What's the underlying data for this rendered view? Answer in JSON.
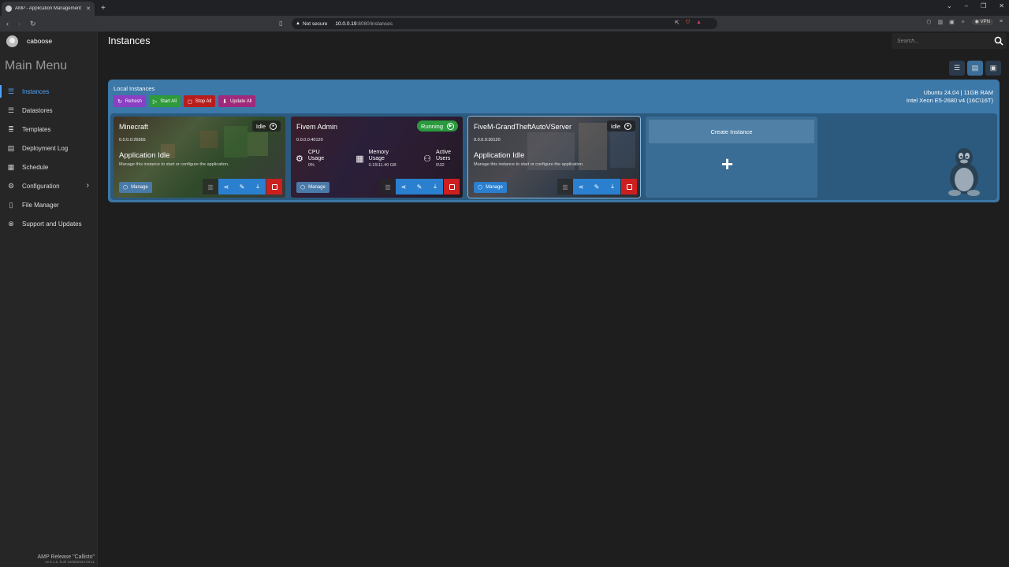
{
  "browser": {
    "tab_title": "AMP - Application Management",
    "url_security": "Not secure",
    "url_host": "10.0.0.19",
    "url_path": ":8080/instances",
    "vpn_label": "VPN"
  },
  "sidebar": {
    "username": "caboose",
    "menu_title": "Main Menu",
    "items": [
      {
        "label": "Instances",
        "icon": "instances-icon"
      },
      {
        "label": "Datastores",
        "icon": "datastores-icon"
      },
      {
        "label": "Templates",
        "icon": "templates-icon"
      },
      {
        "label": "Deployment Log",
        "icon": "deployment-log-icon"
      },
      {
        "label": "Schedule",
        "icon": "schedule-icon"
      },
      {
        "label": "Configuration",
        "icon": "configuration-icon"
      },
      {
        "label": "File Manager",
        "icon": "file-manager-icon"
      },
      {
        "label": "Support and Updates",
        "icon": "support-icon"
      }
    ],
    "release": "AMP Release \"Callisto\"",
    "build": "v2.5.1.6, built 16/08/2024 03:11"
  },
  "header": {
    "title": "Instances",
    "search_placeholder": "Search..."
  },
  "panel": {
    "title": "Local Instances",
    "actions": {
      "refresh": "Refresh",
      "start_all": "Start All",
      "stop_all": "Stop All",
      "update_all": "Update All"
    },
    "os_info": "Ubuntu 24.04 | 11GB RAM",
    "cpu_info": "Intel Xeon E5-2680 v4 (16C\\16T)"
  },
  "instances": [
    {
      "name": "Minecraft",
      "address": "0.0.0.0:25565",
      "status": "Idle",
      "state_title": "Application Idle",
      "state_desc": "Manage this instance to start or configure the application.",
      "manage_label": "Manage"
    },
    {
      "name": "Fivem Admin",
      "address": "0.0.0.0:40120",
      "status": "Running",
      "cpu_label": "CPU Usage",
      "cpu_value": "0%",
      "memory_label": "Memory Usage",
      "memory_value": "0.15\\11.40 GB",
      "users_label": "Active Users",
      "users_value": "0\\32",
      "manage_label": "Manage"
    },
    {
      "name": "FiveM-GrandTheftAutoVServer",
      "address": "0.0.0.0:30120",
      "status": "Idle",
      "state_title": "Application Idle",
      "state_desc": "Manage this instance to start or configure the application.",
      "manage_label": "Manage"
    }
  ],
  "create_instance": {
    "label": "Create Instance",
    "plus": "+"
  },
  "colors": {
    "accent": "#4fa3ff",
    "panel": "#3c78a8",
    "running": "#2a9a3e",
    "stop": "#cc1f1f",
    "refresh": "#8a3fc4",
    "update": "#a0297c"
  }
}
